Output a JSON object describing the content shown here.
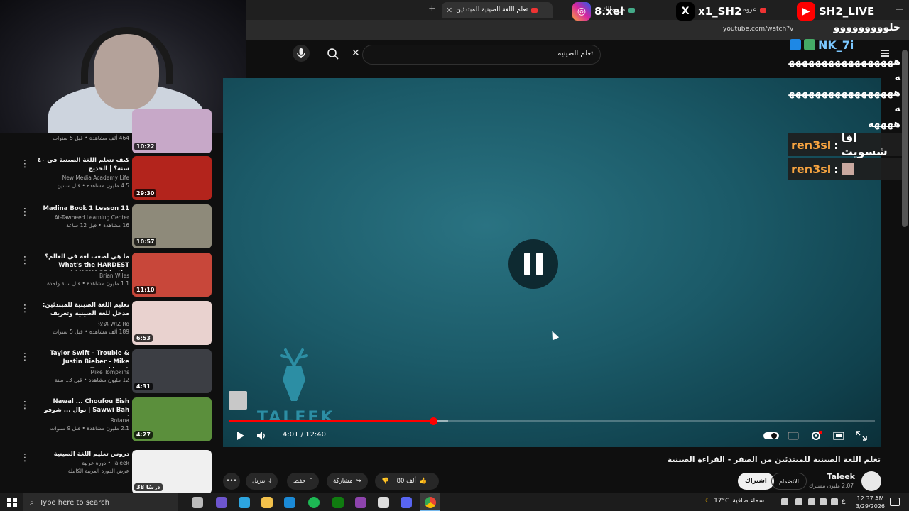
{
  "browser": {
    "tabs": [
      {
        "label": "تعلم اللغة الصينية للمبتدئين",
        "active": true
      },
      {
        "label": "من مالك",
        "active": false
      },
      {
        "label": "عروه",
        "active": false
      }
    ],
    "new_tab_symbol": "+",
    "window_min": "—",
    "url": "youtube.com/watch?v"
  },
  "youtube": {
    "search_value": "تعلم الصينيه",
    "search_clear_symbol": "✕"
  },
  "overlays": {
    "instagram": "8.xel",
    "x": "x1_SH2",
    "youtube": "SH2_LIVE"
  },
  "chat": {
    "lines": [
      "حلووووووووو",
      "هههههههههههههههههه",
      "هههههههههههههههههه",
      "ههههه"
    ],
    "header_name": "NK_7i",
    "rows": [
      {
        "user": "ren3sl",
        "message": "افا شسويت"
      },
      {
        "user": "ren3sl",
        "message": ""
      }
    ],
    "separator": ":"
  },
  "recommendations": [
    {
      "title": "",
      "channel": "",
      "meta": "464 ألف مشاهدة • قبل 5 سنوات",
      "duration": "10:22",
      "thumb": "#c7a8c8"
    },
    {
      "title": "كيف تتعلم اللغة الصينية في ٤٠ سنة؟ | الحديح",
      "channel": "New Media Academy Life",
      "meta": "4.5 مليون مشاهدة • قبل سنتين",
      "duration": "29:30",
      "thumb": "#b3241c"
    },
    {
      "title": "Madina Book 1 Lesson 11",
      "channel": "At-Tawheed Learning Center",
      "meta": "16 مشاهدة • قبل 12 ساعة",
      "duration": "10:57",
      "thumb": "#8e8a7a"
    },
    {
      "title": "ما هي أصعب لغة في العالم؟ What's the HARDEST LANGUAGE in the ...",
      "channel": "Brian Wiles",
      "meta": "1.1 مليون مشاهدة • قبل سنة واحدة",
      "duration": "11:10",
      "thumb": "#c8473a"
    },
    {
      "title": "تعليم اللغة الصينية للمبتدئين: مدخل للغة الصينية وتعريف البينين والنغمات ...",
      "channel": "汉语 WIZ Ro",
      "meta": "189 ألف مشاهدة • قبل 5 سنوات",
      "duration": "6:53",
      "thumb": "#e9d2cf"
    },
    {
      "title": "Taylor Swift - Trouble & Justin Bieber - Mike Tompkins A ...",
      "channel": "Mike Tompkins",
      "meta": "12 مليون مشاهدة • قبل 13 سنة",
      "duration": "4:31",
      "thumb": "#3c3e44"
    },
    {
      "title": "Nawal ... Choufou Eish Sawwi Bah | نوال ... شوفو إشسوي به",
      "channel": "Rotana",
      "meta": "2.1 مليون مشاهدة • قبل 9 سنوات",
      "duration": "4:27",
      "thumb": "#5b8f3c"
    },
    {
      "title": "دروس تعليم اللغة الصينية",
      "channel": "Taleek • دورة عربية",
      "meta": "عرض الدورة العربية الكاملة",
      "duration": "38 درسًا",
      "thumb": "#f0f0f0"
    }
  ],
  "player": {
    "current_time": "4:01",
    "duration": "12:40",
    "time_separator": " / ",
    "progress_fraction": 0.317,
    "buffered_fraction": 0.34,
    "watermark": "TALEEK",
    "state": "paused"
  },
  "video": {
    "title": "تعلم اللغة الصينية للمبتدئين من الصفر - القراءة الصينية",
    "channel": "Taleek",
    "subscribers": "2.07 مليون مشترك",
    "subscribe_label": "اشتراك",
    "join_label": "الانضمام",
    "like_count": "80 ألف",
    "share_label": "مشاركة",
    "save_label": "حفظ",
    "download_label": "تنزيل"
  },
  "taskbar": {
    "search_placeholder": "Type here to search",
    "temperature": "17°C",
    "weather_text": "سماء صافية",
    "language": "ع",
    "time": "12:37 AM",
    "date": "3/29/2026"
  },
  "colors": {
    "progress": "#ff0000",
    "chat_user": "#f7a440",
    "player_bg": "#1b5a68"
  }
}
